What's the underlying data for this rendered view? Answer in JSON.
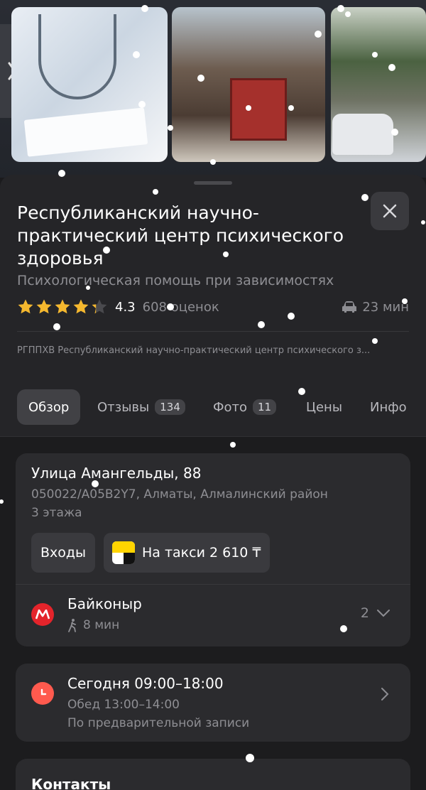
{
  "photos": [
    {
      "subject": "doctor with stethoscope"
    },
    {
      "subject": "red gate of building"
    },
    {
      "subject": "courtyard with car"
    }
  ],
  "place": {
    "title": "Республиканский научно-практический центр психического здоровья",
    "category": "Психологическая помощь при зависимостях",
    "rating": "4.3",
    "rating_stars": 4.3,
    "reviews": "608 оценок",
    "drive_time": "23 мин",
    "legal_name": "РГППХВ Республиканский научно-практический центр психического з..."
  },
  "tabs": [
    {
      "label": "Обзор",
      "active": true
    },
    {
      "label": "Отзывы",
      "count": "134"
    },
    {
      "label": "Фото",
      "count": "11"
    },
    {
      "label": "Цены"
    },
    {
      "label": "Инфо"
    }
  ],
  "address": {
    "street": "Улица Амангельды, 88",
    "postal": "050022/A05B2Y7, Алматы, Алмалинский район",
    "floors": "3 этажа",
    "entrances_label": "Входы",
    "taxi_label": "На такси 2 610 ₸"
  },
  "metro": {
    "station": "Байконыр",
    "walk": "8 мин",
    "count": "2"
  },
  "hours": {
    "today": "Сегодня 09:00–18:00",
    "lunch": "Обед 13:00–14:00",
    "note": "По предварительной записи"
  },
  "contacts": {
    "title": "Контакты"
  },
  "colors": {
    "sheet": "#252528",
    "metro": "#e4242b",
    "clock": "#ff5a4e",
    "star": "#f5b82e",
    "taxi_yellow": "#ffd400"
  }
}
